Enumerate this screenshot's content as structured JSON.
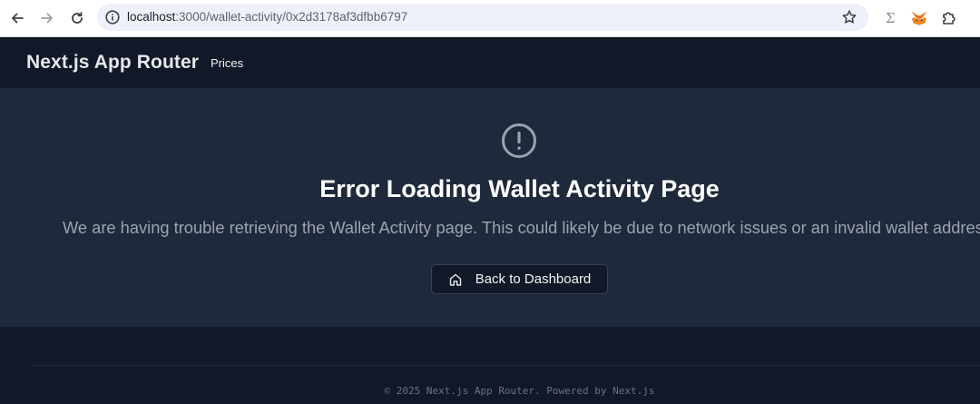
{
  "browser": {
    "url_host": "localhost",
    "url_path": ":3000/wallet-activity/0x2d3178af3dfbb6797",
    "extension_sigma": "Σ"
  },
  "header": {
    "brand": "Next.js App Router",
    "nav": [
      {
        "label": "Prices"
      }
    ]
  },
  "error": {
    "title": "Error Loading Wallet Activity Page",
    "message": "We are having trouble retrieving the Wallet Activity page. This could likely be due to network issues or an invalid wallet address.",
    "button_label": "Back to Dashboard"
  },
  "footer": {
    "text": "© 2025 Next.js App Router. Powered by Next.js"
  },
  "colors": {
    "page_bg": "#111827",
    "panel_bg": "#1e293b",
    "title": "#ffffff",
    "message": "#9ca3af",
    "icon": "#9ca3af"
  },
  "icons": {
    "error": "exclamation-circle-icon",
    "button": "home-icon"
  }
}
